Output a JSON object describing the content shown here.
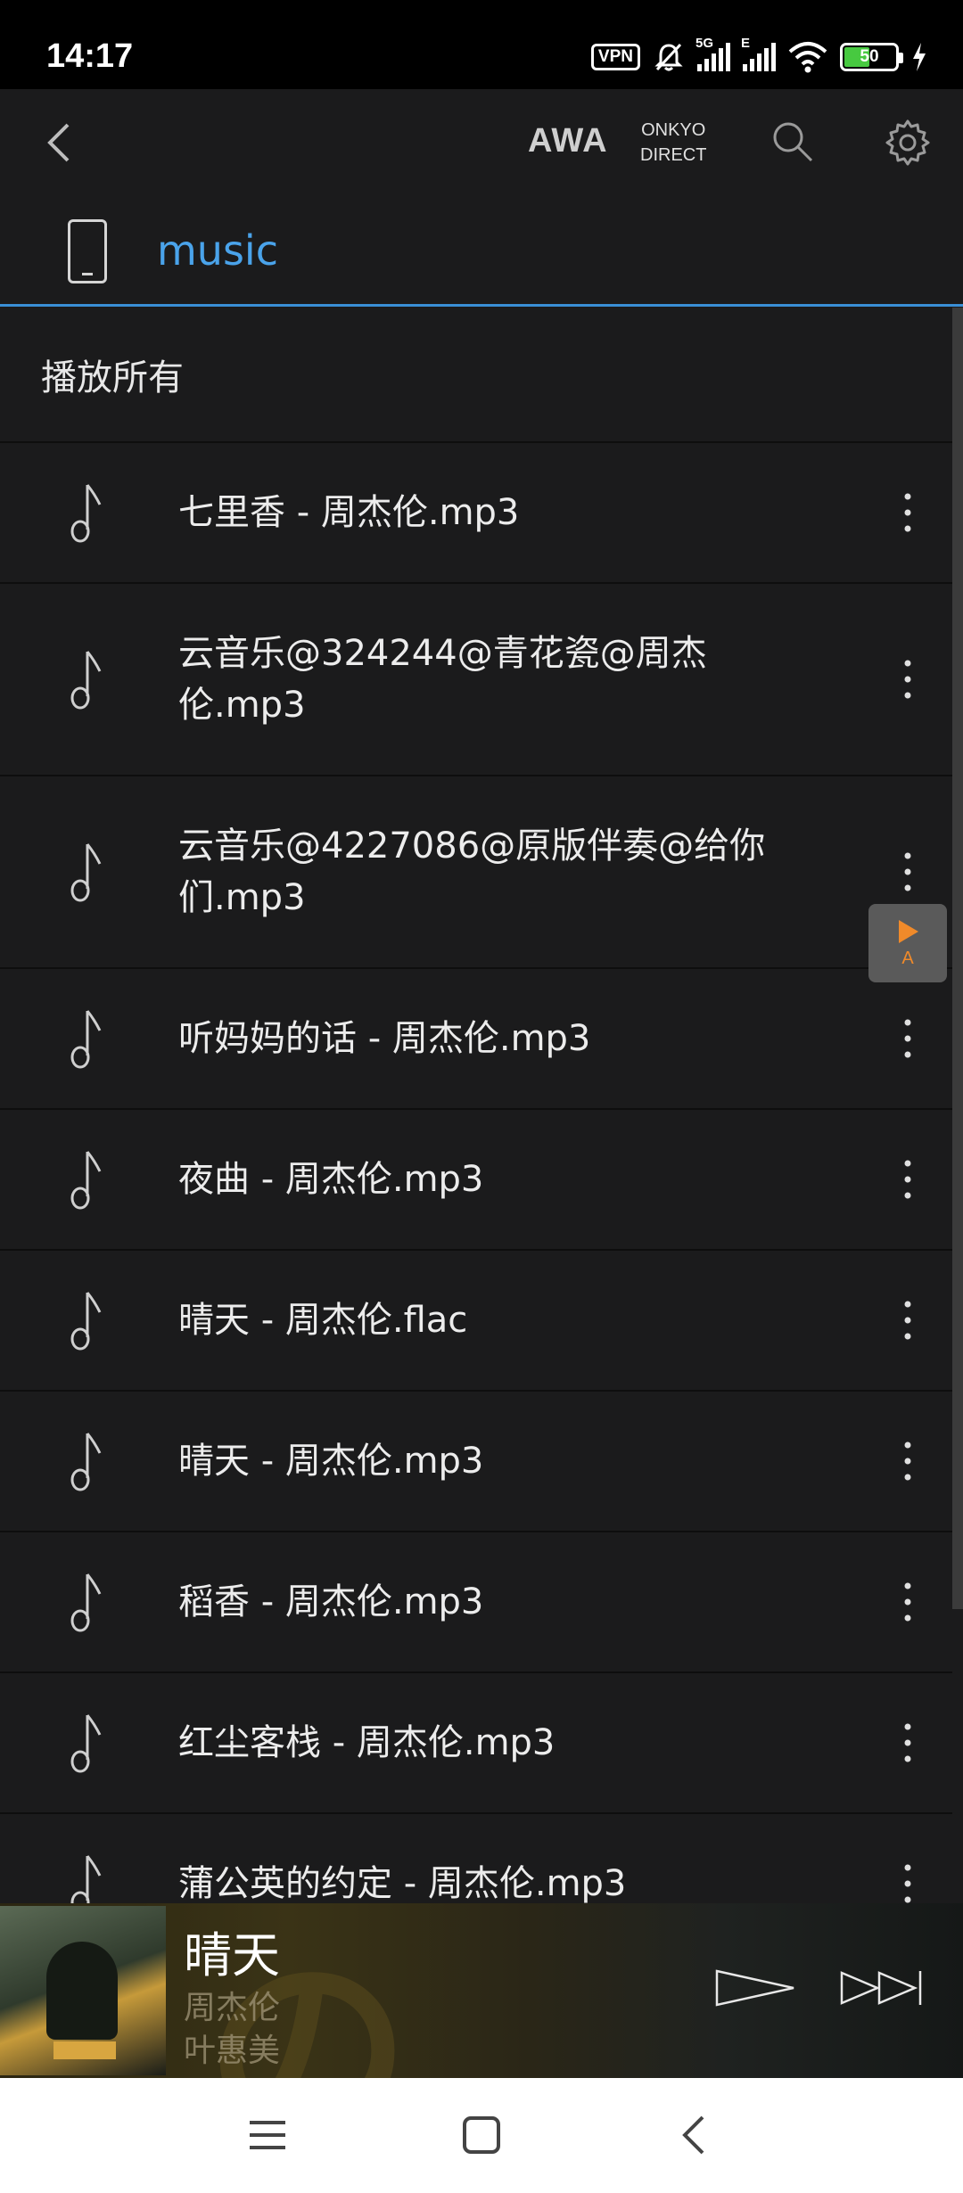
{
  "status_bar": {
    "time": "14:17",
    "vpn": "VPN",
    "network": "5G",
    "network2": "E",
    "battery": "50"
  },
  "app_bar": {
    "awa": "AWA",
    "onkyo_line1": "ONKYO",
    "onkyo_line2": "DIRECT"
  },
  "location": {
    "title": "music"
  },
  "list": {
    "play_all": "播放所有",
    "tracks": [
      {
        "name": "七里香 - 周杰伦.mp3"
      },
      {
        "name": "云音乐@324244@青花瓷@周杰伦.mp3"
      },
      {
        "name": "云音乐@4227086@原版伴奏@给你们.mp3"
      },
      {
        "name": "听妈妈的话 - 周杰伦.mp3"
      },
      {
        "name": "夜曲 - 周杰伦.mp3"
      },
      {
        "name": "晴天 - 周杰伦.flac"
      },
      {
        "name": "晴天 - 周杰伦.mp3"
      },
      {
        "name": "稻香 - 周杰伦.mp3"
      },
      {
        "name": "红尘客栈 - 周杰伦.mp3"
      },
      {
        "name": "蒲公英的约定 - 周杰伦.mp3"
      }
    ]
  },
  "float_button": {
    "letter": "A"
  },
  "player": {
    "title": "晴天",
    "artist": "周杰伦",
    "lyricist": "叶惠美"
  },
  "colors": {
    "accent": "#4aa3ea",
    "float_accent": "#f08a2a",
    "background": "#1b1b1c"
  }
}
